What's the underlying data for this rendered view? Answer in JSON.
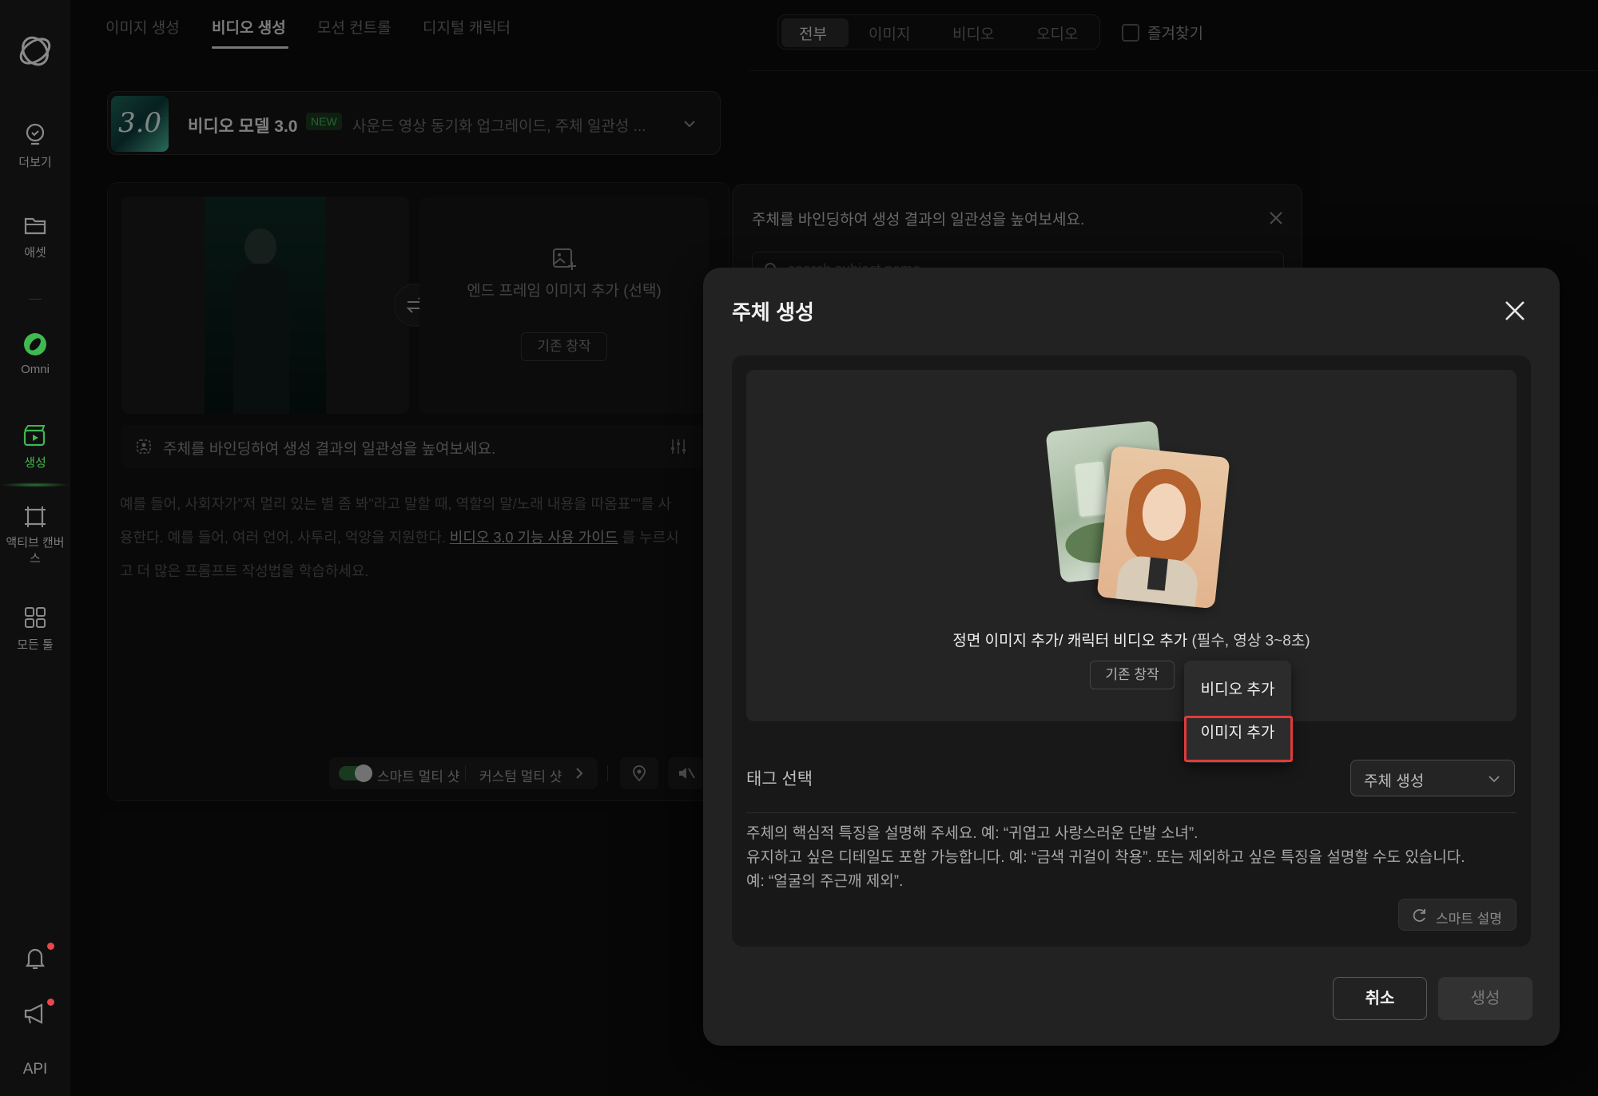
{
  "sidebar": {
    "items": [
      {
        "label": "더보기",
        "icon": "lightbulb-icon"
      },
      {
        "label": "애셋",
        "icon": "folder-icon"
      },
      {
        "label": "Omni",
        "icon": "omni-logo-icon"
      },
      {
        "label": "생성",
        "icon": "clapperboard-icon"
      },
      {
        "label": "액티브 캔버스",
        "icon": "canvas-icon"
      },
      {
        "label": "모든 툴",
        "icon": "grid-icon"
      }
    ],
    "api_label": "API",
    "accent": "#3fb950"
  },
  "top_tabs": [
    "이미지 생성",
    "비디오 생성",
    "모션 컨트롤",
    "디지털 캐릭터"
  ],
  "active_tab": "비디오 생성",
  "model": {
    "badge": "3.0",
    "name": "비디오 모델 3.0",
    "new_tag": "NEW",
    "description": "사운드 영상 동기화 업그레이드, 주체 일관성 ..."
  },
  "frames": {
    "end_frame_label": "엔드 프레임 이미지 추가 (선택)",
    "existing_button": "기존 창작"
  },
  "subject_bar_text": "주체를 바인딩하여 생성 결과의 일관성을 높여보세요.",
  "prompt_hint": {
    "line1": "예를 들어, 사회자가\"저 멀리 있는 별 좀 봐\"라고 말할 때, 역할의 말/노래 내용을 따옴표\"\"를 사",
    "line2_prefix": "용한다. 예를 들어, 여러 언어, 사투리, 억양을 지원한다.",
    "line2_link": "비디오 3.0 기능 사용 가이드",
    "line2_suffix": "를 누르시",
    "line3": "고 더 많은 프롬프트 작성법을 학습하세요."
  },
  "bottom_controls": {
    "smart_multi_shot": "스마트 멀티 샷",
    "custom_multi_shot": "커스텀 멀티 샷"
  },
  "filter_tabs": [
    "전부",
    "이미지",
    "비디오",
    "오디오"
  ],
  "active_filter": "전부",
  "favorites_label": "즐겨찾기",
  "bg_subject_panel": {
    "title": "주체를 바인딩하여 생성 결과의 일관성을 높여보세요.",
    "search_placeholder": "search subject name"
  },
  "modal": {
    "title": "주체 생성",
    "upload_caption": "정면 이미지 추가/ 캐릭터 비디오 추가",
    "upload_caption_note": "(필수, 영상 3~8초)",
    "existing_button": "기존 창작",
    "dropdown_items": [
      "비디오 추가",
      "이미지 추가"
    ],
    "tag_label": "태그 선택",
    "tag_select_value": "주체 생성",
    "description_lines": [
      "주체의 핵심적 특징을 설명해 주세요. 예: “귀엽고 사랑스러운 단발 소녀”.",
      "유지하고 싶은 디테일도 포함 가능합니다. 예: “금색 귀걸이 착용”. 또는 제외하고 싶은 특징을 설명할 수도 있습니다.",
      "예: “얼굴의 주근깨 제외”."
    ],
    "smart_describe": "스마트 설명",
    "cancel": "취소",
    "create": "생성"
  }
}
